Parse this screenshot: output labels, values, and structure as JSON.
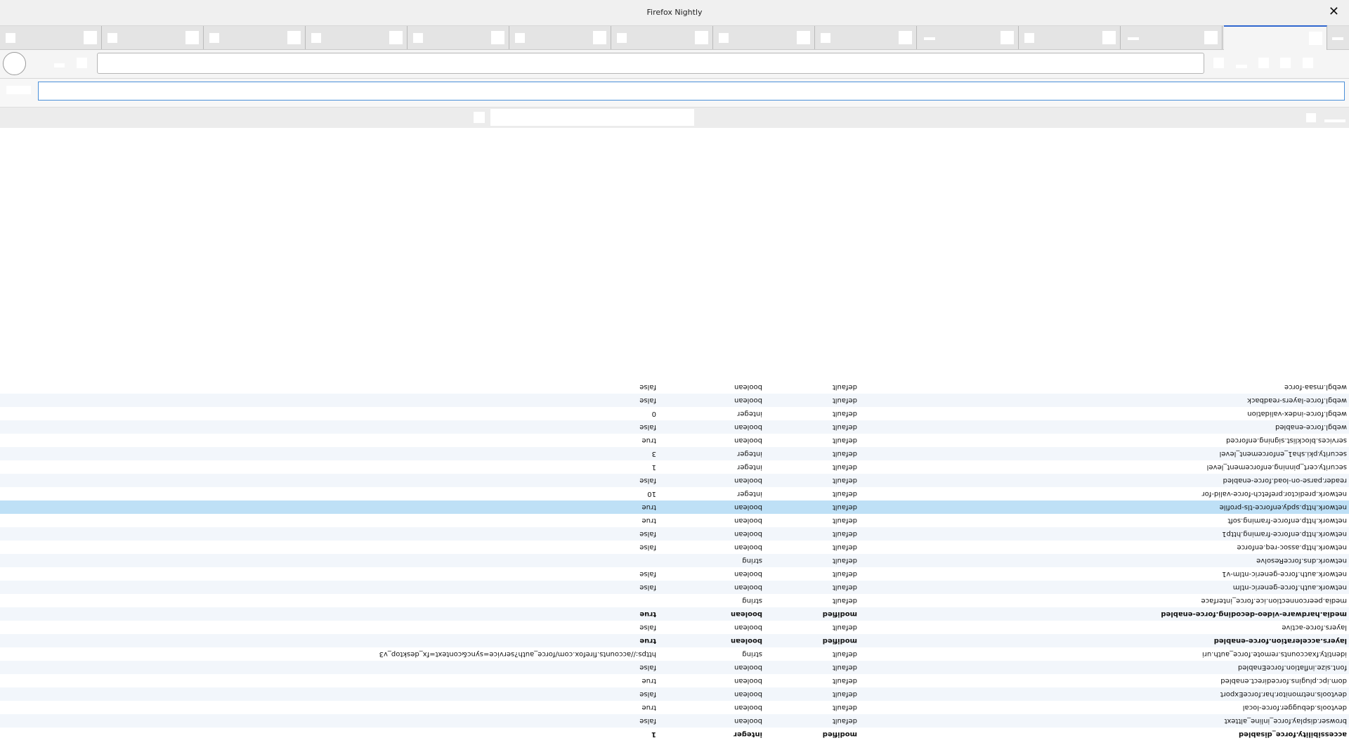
{
  "window": {
    "title": "Firefox Nightly",
    "close_glyph": "✕"
  },
  "prefs": [
    {
      "name": "accessibility.force_disabled",
      "status": "modified",
      "type": "integer",
      "value": "1"
    },
    {
      "name": "browser.display.force_inline_alttext",
      "status": "default",
      "type": "boolean",
      "value": "false"
    },
    {
      "name": "devtools.debugger.force-local",
      "status": "default",
      "type": "boolean",
      "value": "true"
    },
    {
      "name": "devtools.netmonitor.har.forceExport",
      "status": "default",
      "type": "boolean",
      "value": "false"
    },
    {
      "name": "dom.ipc.plugins.forcedirect.enabled",
      "status": "default",
      "type": "boolean",
      "value": "true"
    },
    {
      "name": "font.size.inflation.forceEnabled",
      "status": "default",
      "type": "boolean",
      "value": "false"
    },
    {
      "name": "identity.fxaccounts.remote.force_auth.uri",
      "status": "default",
      "type": "string",
      "value": "https://accounts.firefox.com/force_auth?service=sync&context=fx_desktop_v3"
    },
    {
      "name": "layers.acceleration.force-enabled",
      "status": "modified",
      "type": "boolean",
      "value": "true"
    },
    {
      "name": "layers.force-active",
      "status": "default",
      "type": "boolean",
      "value": "false"
    },
    {
      "name": "media.hardware-video-decoding.force-enabled",
      "status": "modified",
      "type": "boolean",
      "value": "true"
    },
    {
      "name": "media.peerconnection.ice.force_interface",
      "status": "default",
      "type": "string",
      "value": ""
    },
    {
      "name": "network.auth.force-generic-ntlm",
      "status": "default",
      "type": "boolean",
      "value": "false"
    },
    {
      "name": "network.auth.force-generic-ntlm-v1",
      "status": "default",
      "type": "boolean",
      "value": "false"
    },
    {
      "name": "network.dns.forceResolve",
      "status": "default",
      "type": "string",
      "value": ""
    },
    {
      "name": "network.http.assoc-req.enforce",
      "status": "default",
      "type": "boolean",
      "value": "false"
    },
    {
      "name": "network.http.enforce-framing.http1",
      "status": "default",
      "type": "boolean",
      "value": "false"
    },
    {
      "name": "network.http.enforce-framing.soft",
      "status": "default",
      "type": "boolean",
      "value": "true"
    },
    {
      "name": "network.http.spdy.enforce-tls-profile",
      "status": "default",
      "type": "boolean",
      "value": "true",
      "selected": true
    },
    {
      "name": "network.predictor.prefetch-force-valid-for",
      "status": "default",
      "type": "integer",
      "value": "10"
    },
    {
      "name": "reader.parse-on-load.force-enabled",
      "status": "default",
      "type": "boolean",
      "value": "false"
    },
    {
      "name": "security.cert_pinning.enforcement_level",
      "status": "default",
      "type": "integer",
      "value": "1"
    },
    {
      "name": "security.pki.sha1_enforcement_level",
      "status": "default",
      "type": "integer",
      "value": "3"
    },
    {
      "name": "services.blocklist.signing.enforced",
      "status": "default",
      "type": "boolean",
      "value": "true"
    },
    {
      "name": "webgl.force-enabled",
      "status": "default",
      "type": "boolean",
      "value": "false"
    },
    {
      "name": "webgl.force-index-validation",
      "status": "default",
      "type": "integer",
      "value": "0"
    },
    {
      "name": "webgl.force-layers-readback",
      "status": "default",
      "type": "boolean",
      "value": "false"
    },
    {
      "name": "webgl.msaa-force",
      "status": "default",
      "type": "boolean",
      "value": "false"
    }
  ]
}
